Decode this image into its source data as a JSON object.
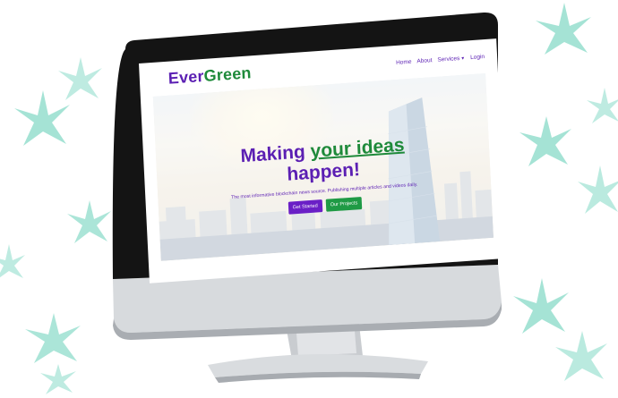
{
  "brand": {
    "part1": "Ever",
    "part2": "Green"
  },
  "nav": {
    "home": "Home",
    "about": "About",
    "services": "Services",
    "login": "Login"
  },
  "hero": {
    "title_part1": "Making ",
    "title_highlight": "your ideas",
    "title_part2": "happen!",
    "subtitle": "The most informative blockchain news source. Publishing multiple articles and videos daily.",
    "primary_button": "Get Started",
    "secondary_button": "Our Projects"
  },
  "colors": {
    "brand_purple": "#5b1fb3",
    "brand_green": "#1e8a3a",
    "leaf": "#7fd6c4"
  }
}
